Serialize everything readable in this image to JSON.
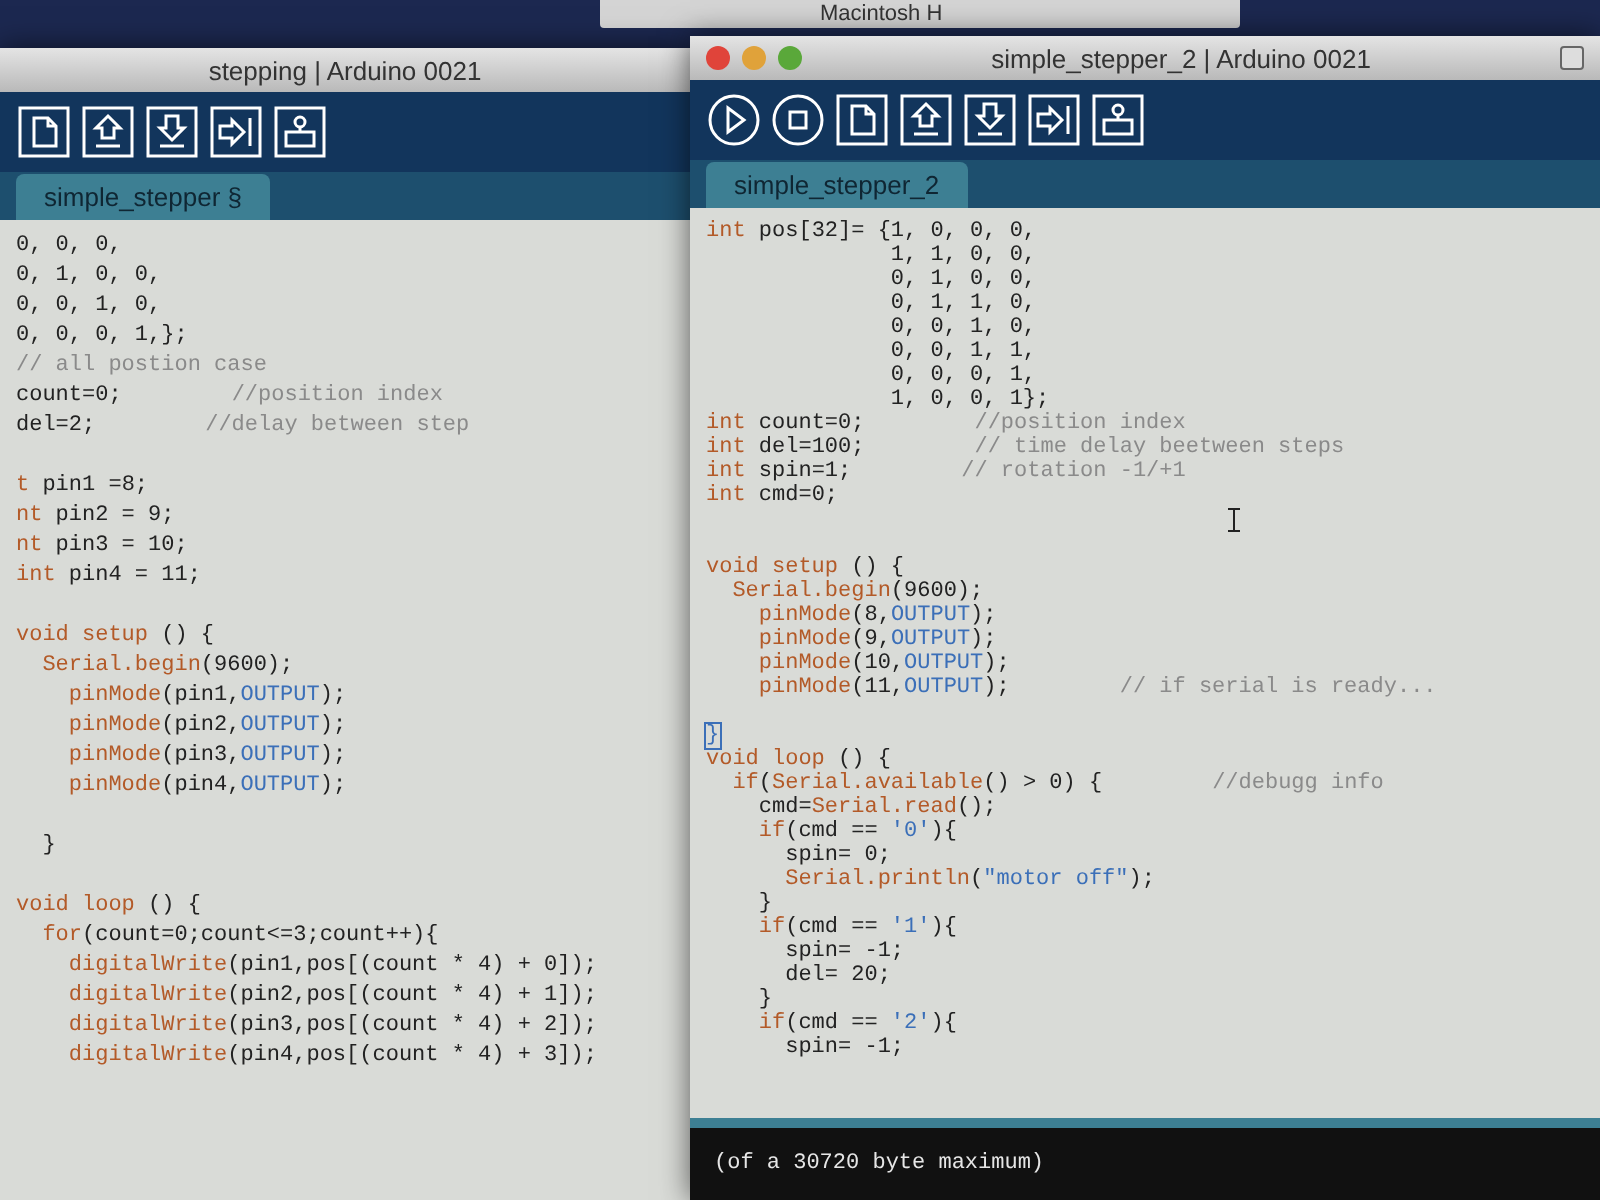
{
  "desktop": {
    "background_window_title": "Macintosh H"
  },
  "windows": [
    {
      "title": "stepping | Arduino 0021",
      "kind": "back",
      "toolbar": [
        {
          "kind": "new"
        },
        {
          "kind": "open"
        },
        {
          "kind": "save"
        },
        {
          "kind": "upload"
        },
        {
          "kind": "serial_monitor"
        }
      ],
      "tab": {
        "label": "simple_stepper §",
        "selected": true
      },
      "lines": [
        {
          "tokens": [
            {
              "text": "0, 0, 0,",
              "kind": "plain"
            }
          ]
        },
        {
          "tokens": [
            {
              "text": "0, 1, 0, 0,",
              "kind": "plain"
            }
          ]
        },
        {
          "tokens": [
            {
              "text": "0, 0, 1, 0,",
              "kind": "plain"
            }
          ]
        },
        {
          "tokens": [
            {
              "text": "0, 0, 0, 1,};",
              "kind": "plain"
            }
          ]
        },
        {
          "tokens": [
            {
              "text": "// all postion case",
              "kind": "comment"
            }
          ]
        },
        {
          "tokens": [
            {
              "text": "count=0;",
              "kind": "plain"
            }
          ],
          "comment": "//position index"
        },
        {
          "tokens": [
            {
              "text": "del=2;",
              "kind": "plain"
            }
          ],
          "comment": "//delay between step"
        },
        {
          "kind": "blank"
        },
        {
          "tokens": [
            {
              "text": "t",
              "kind": "keyword"
            },
            {
              "text": " pin1 =8;",
              "kind": "plain"
            }
          ]
        },
        {
          "tokens": [
            {
              "text": "nt",
              "kind": "keyword"
            },
            {
              "text": " pin2 = 9;",
              "kind": "plain"
            }
          ]
        },
        {
          "tokens": [
            {
              "text": "nt",
              "kind": "keyword"
            },
            {
              "text": " pin3 = 10;",
              "kind": "plain"
            }
          ]
        },
        {
          "tokens": [
            {
              "text": "int",
              "kind": "keyword"
            },
            {
              "text": " pin4 = 11;",
              "kind": "plain"
            }
          ]
        },
        {
          "kind": "blank"
        },
        {
          "tokens": [
            {
              "text": "void setup",
              "kind": "keyword"
            },
            {
              "text": " () {",
              "kind": "plain"
            }
          ]
        },
        {
          "tokens": [
            {
              "text": "  Serial.begin",
              "kind": "keyword"
            },
            {
              "text": "(9600);",
              "kind": "plain"
            }
          ]
        },
        {
          "tokens": [
            {
              "text": "    pinMode",
              "kind": "keyword"
            },
            {
              "text": "(pin1,",
              "kind": "plain"
            },
            {
              "text": "OUTPUT",
              "kind": "constant"
            },
            {
              "text": ");",
              "kind": "plain"
            }
          ]
        },
        {
          "tokens": [
            {
              "text": "    pinMode",
              "kind": "keyword"
            },
            {
              "text": "(pin2,",
              "kind": "plain"
            },
            {
              "text": "OUTPUT",
              "kind": "constant"
            },
            {
              "text": ");",
              "kind": "plain"
            }
          ]
        },
        {
          "tokens": [
            {
              "text": "    pinMode",
              "kind": "keyword"
            },
            {
              "text": "(pin3,",
              "kind": "plain"
            },
            {
              "text": "OUTPUT",
              "kind": "constant"
            },
            {
              "text": ");",
              "kind": "plain"
            }
          ]
        },
        {
          "tokens": [
            {
              "text": "    pinMode",
              "kind": "keyword"
            },
            {
              "text": "(pin4,",
              "kind": "plain"
            },
            {
              "text": "OUTPUT",
              "kind": "constant"
            },
            {
              "text": ");",
              "kind": "plain"
            }
          ]
        },
        {
          "kind": "blank"
        },
        {
          "tokens": [
            {
              "text": "  }",
              "kind": "plain"
            }
          ]
        },
        {
          "kind": "blank"
        },
        {
          "tokens": [
            {
              "text": "void loop",
              "kind": "keyword"
            },
            {
              "text": " () {",
              "kind": "plain"
            }
          ]
        },
        {
          "tokens": [
            {
              "text": "  for",
              "kind": "keyword"
            },
            {
              "text": "(count=0;count<=3;count++){",
              "kind": "plain"
            }
          ]
        },
        {
          "tokens": [
            {
              "text": "    digitalWrite",
              "kind": "keyword"
            },
            {
              "text": "(pin1,pos[(count * 4) + 0]);",
              "kind": "plain"
            }
          ]
        },
        {
          "tokens": [
            {
              "text": "    digitalWrite",
              "kind": "keyword"
            },
            {
              "text": "(pin2,pos[(count * 4) + 1]);",
              "kind": "plain"
            }
          ]
        },
        {
          "tokens": [
            {
              "text": "    digitalWrite",
              "kind": "keyword"
            },
            {
              "text": "(pin3,pos[(count * 4) + 2]);",
              "kind": "plain"
            }
          ]
        },
        {
          "tokens": [
            {
              "text": "    digitalWrite",
              "kind": "keyword"
            },
            {
              "text": "(pin4,pos[(count * 4) + 3]);",
              "kind": "plain"
            }
          ]
        }
      ]
    },
    {
      "title": "simple_stepper_2 | Arduino 0021",
      "kind": "front",
      "toolbar": [
        {
          "kind": "verify"
        },
        {
          "kind": "stop"
        },
        {
          "kind": "new"
        },
        {
          "kind": "open"
        },
        {
          "kind": "save"
        },
        {
          "kind": "upload"
        },
        {
          "kind": "serial_monitor"
        }
      ],
      "tab": {
        "label": "simple_stepper_2",
        "selected": true
      },
      "lines": [
        {
          "tokens": [
            {
              "text": "int",
              "kind": "keyword"
            },
            {
              "text": " pos[32]= {1, 0, 0, 0,",
              "kind": "plain"
            }
          ]
        },
        {
          "tokens": [
            {
              "text": "              1, 1, 0, 0,",
              "kind": "plain"
            }
          ]
        },
        {
          "tokens": [
            {
              "text": "              0, 1, 0, 0,",
              "kind": "plain"
            }
          ]
        },
        {
          "tokens": [
            {
              "text": "              0, 1, 1, 0,",
              "kind": "plain"
            }
          ]
        },
        {
          "tokens": [
            {
              "text": "              0, 0, 1, 0,",
              "kind": "plain"
            }
          ]
        },
        {
          "tokens": [
            {
              "text": "              0, 0, 1, 1,",
              "kind": "plain"
            }
          ]
        },
        {
          "tokens": [
            {
              "text": "              0, 0, 0, 1,",
              "kind": "plain"
            }
          ]
        },
        {
          "tokens": [
            {
              "text": "              1, 0, 0, 1};",
              "kind": "plain"
            }
          ]
        },
        {
          "tokens": [
            {
              "text": "int",
              "kind": "keyword"
            },
            {
              "text": " count=0;",
              "kind": "plain"
            }
          ],
          "comment": "//position index"
        },
        {
          "tokens": [
            {
              "text": "int",
              "kind": "keyword"
            },
            {
              "text": " del=100;",
              "kind": "plain"
            }
          ],
          "comment": "// time delay beetween steps"
        },
        {
          "tokens": [
            {
              "text": "int",
              "kind": "keyword"
            },
            {
              "text": " spin=1;",
              "kind": "plain"
            }
          ],
          "comment": "// rotation -1/+1"
        },
        {
          "tokens": [
            {
              "text": "int",
              "kind": "keyword"
            },
            {
              "text": " cmd=0;",
              "kind": "plain"
            }
          ]
        },
        {
          "kind": "blank"
        },
        {
          "kind": "blank"
        },
        {
          "tokens": [
            {
              "text": "void setup",
              "kind": "keyword"
            },
            {
              "text": " () {",
              "kind": "plain"
            }
          ]
        },
        {
          "tokens": [
            {
              "text": "  Serial.begin",
              "kind": "keyword"
            },
            {
              "text": "(9600);",
              "kind": "plain"
            }
          ]
        },
        {
          "tokens": [
            {
              "text": "    pinMode",
              "kind": "keyword"
            },
            {
              "text": "(8,",
              "kind": "plain"
            },
            {
              "text": "OUTPUT",
              "kind": "constant"
            },
            {
              "text": ");",
              "kind": "plain"
            }
          ]
        },
        {
          "tokens": [
            {
              "text": "    pinMode",
              "kind": "keyword"
            },
            {
              "text": "(9,",
              "kind": "plain"
            },
            {
              "text": "OUTPUT",
              "kind": "constant"
            },
            {
              "text": ");",
              "kind": "plain"
            }
          ]
        },
        {
          "tokens": [
            {
              "text": "    pinMode",
              "kind": "keyword"
            },
            {
              "text": "(10,",
              "kind": "plain"
            },
            {
              "text": "OUTPUT",
              "kind": "constant"
            },
            {
              "text": ");",
              "kind": "plain"
            }
          ]
        },
        {
          "tokens": [
            {
              "text": "    pinMode",
              "kind": "keyword"
            },
            {
              "text": "(11,",
              "kind": "plain"
            },
            {
              "text": "OUTPUT",
              "kind": "constant"
            },
            {
              "text": ");",
              "kind": "plain"
            }
          ],
          "comment": "// if serial is ready..."
        },
        {
          "kind": "blank"
        },
        {
          "tokens": [
            {
              "text": "}",
              "kind": "matched_bracket"
            }
          ]
        },
        {
          "tokens": [
            {
              "text": "void loop",
              "kind": "keyword"
            },
            {
              "text": " () {",
              "kind": "plain"
            }
          ]
        },
        {
          "tokens": [
            {
              "text": "  if",
              "kind": "keyword"
            },
            {
              "text": "(",
              "kind": "plain"
            },
            {
              "text": "Serial.available",
              "kind": "keyword"
            },
            {
              "text": "() > 0) {",
              "kind": "plain"
            }
          ],
          "comment": "//debugg info"
        },
        {
          "tokens": [
            {
              "text": "    cmd=",
              "kind": "plain"
            },
            {
              "text": "Serial.read",
              "kind": "keyword"
            },
            {
              "text": "();",
              "kind": "plain"
            }
          ]
        },
        {
          "tokens": [
            {
              "text": "    if",
              "kind": "keyword"
            },
            {
              "text": "(cmd == ",
              "kind": "plain"
            },
            {
              "text": "'0'",
              "kind": "constant"
            },
            {
              "text": "){",
              "kind": "plain"
            }
          ]
        },
        {
          "tokens": [
            {
              "text": "      spin= 0;",
              "kind": "plain"
            }
          ]
        },
        {
          "tokens": [
            {
              "text": "      Serial.println",
              "kind": "keyword"
            },
            {
              "text": "(",
              "kind": "plain"
            },
            {
              "text": "\"motor off\"",
              "kind": "constant"
            },
            {
              "text": ");",
              "kind": "plain"
            }
          ]
        },
        {
          "tokens": [
            {
              "text": "    }",
              "kind": "plain"
            }
          ]
        },
        {
          "tokens": [
            {
              "text": "    if",
              "kind": "keyword"
            },
            {
              "text": "(cmd == ",
              "kind": "plain"
            },
            {
              "text": "'1'",
              "kind": "constant"
            },
            {
              "text": "){",
              "kind": "plain"
            }
          ]
        },
        {
          "tokens": [
            {
              "text": "      spin= -1;",
              "kind": "plain"
            }
          ]
        },
        {
          "tokens": [
            {
              "text": "      del= 20;",
              "kind": "plain"
            }
          ]
        },
        {
          "tokens": [
            {
              "text": "    }",
              "kind": "plain"
            }
          ]
        },
        {
          "tokens": [
            {
              "text": "    if",
              "kind": "keyword"
            },
            {
              "text": "(cmd == ",
              "kind": "plain"
            },
            {
              "text": "'2'",
              "kind": "constant"
            },
            {
              "text": "){",
              "kind": "plain"
            }
          ]
        },
        {
          "tokens": [
            {
              "text": "      spin= -1;",
              "kind": "plain"
            }
          ]
        }
      ],
      "console": {
        "text": "(of a 30720 byte maximum)"
      }
    }
  ]
}
